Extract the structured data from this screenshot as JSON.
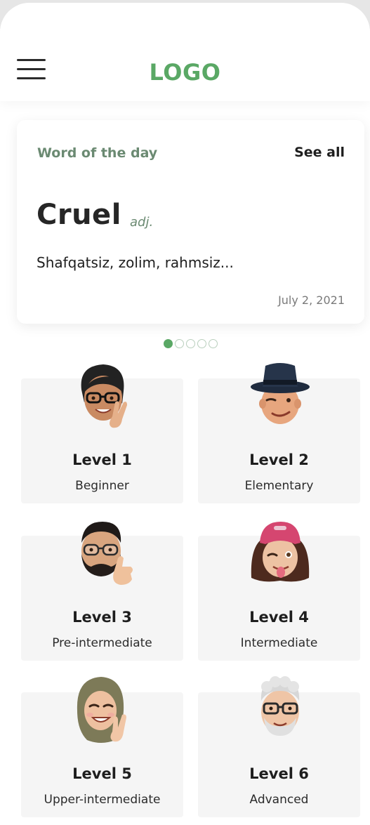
{
  "header": {
    "logo": "LOGO",
    "logo_color": "#5aa865"
  },
  "word_of_day": {
    "title": "Word of the day",
    "see_all": "See all",
    "word": "Cruel",
    "part_of_speech": "adj.",
    "definition": "Shafqatsiz, zolim, rahmsiz...",
    "date": "July 2, 2021"
  },
  "carousel": {
    "total_dots": 5,
    "active_index": 0
  },
  "levels": [
    {
      "name": "Level 1",
      "desc": "Beginner",
      "avatar": "memoji-woman-glasses-peace"
    },
    {
      "name": "Level 2",
      "desc": "Elementary",
      "avatar": "memoji-man-hat-wink"
    },
    {
      "name": "Level 3",
      "desc": "Pre-intermediate",
      "avatar": "memoji-man-beard-thumbs-up"
    },
    {
      "name": "Level 4",
      "desc": "Intermediate",
      "avatar": "memoji-woman-cap-tongue"
    },
    {
      "name": "Level 5",
      "desc": "Upper-intermediate",
      "avatar": "memoji-woman-hijab-peace"
    },
    {
      "name": "Level 6",
      "desc": "Advanced",
      "avatar": "memoji-old-man-glasses"
    }
  ]
}
